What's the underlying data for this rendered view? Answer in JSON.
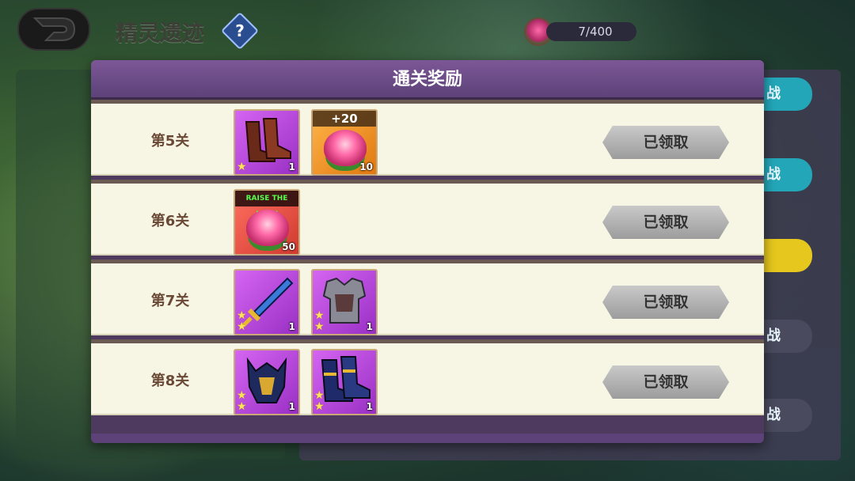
{
  "header": {
    "title": "精灵遗迹",
    "help": "?",
    "counter": "7/400"
  },
  "side_buttons": [
    "战",
    "战",
    "",
    "战",
    "战"
  ],
  "modal": {
    "title": "通关奖励",
    "rows": [
      {
        "label": "第5关",
        "claim": "已领取",
        "items": [
          {
            "kind": "boots",
            "color": "purple",
            "stars": 1,
            "count": "1",
            "badge": ""
          },
          {
            "kind": "flower",
            "color": "orange",
            "stars": 0,
            "count": "10",
            "badge": "+20"
          }
        ]
      },
      {
        "label": "第6关",
        "claim": "已领取",
        "items": [
          {
            "kind": "flower",
            "color": "red",
            "stars": 0,
            "count": "50",
            "badge": "RAISE THE LIMIT"
          }
        ]
      },
      {
        "label": "第7关",
        "claim": "已领取",
        "items": [
          {
            "kind": "sword",
            "color": "purple",
            "stars": 2,
            "count": "1",
            "badge": ""
          },
          {
            "kind": "armor",
            "color": "purple",
            "stars": 2,
            "count": "1",
            "badge": ""
          }
        ]
      },
      {
        "label": "第8关",
        "claim": "已领取",
        "items": [
          {
            "kind": "helmet",
            "color": "purple",
            "stars": 2,
            "count": "1",
            "badge": ""
          },
          {
            "kind": "boots",
            "color": "purple",
            "stars": 2,
            "count": "1",
            "badge": ""
          }
        ]
      }
    ]
  }
}
